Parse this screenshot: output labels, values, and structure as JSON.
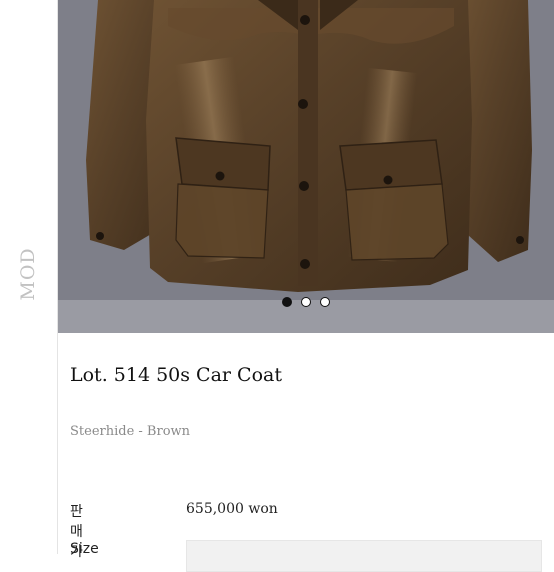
{
  "sidebar": {
    "logo": "MOD"
  },
  "gallery": {
    "slide_count": 3,
    "active_index": 0
  },
  "product": {
    "name": "Lot. 514 50s Car Coat",
    "subtitle": "Steerhide - Brown",
    "price_label": "판매가",
    "price_value": "655,000 won",
    "size_label": "Size"
  },
  "colors": {
    "leather": "#5e4428",
    "background": "#7b7c86"
  }
}
